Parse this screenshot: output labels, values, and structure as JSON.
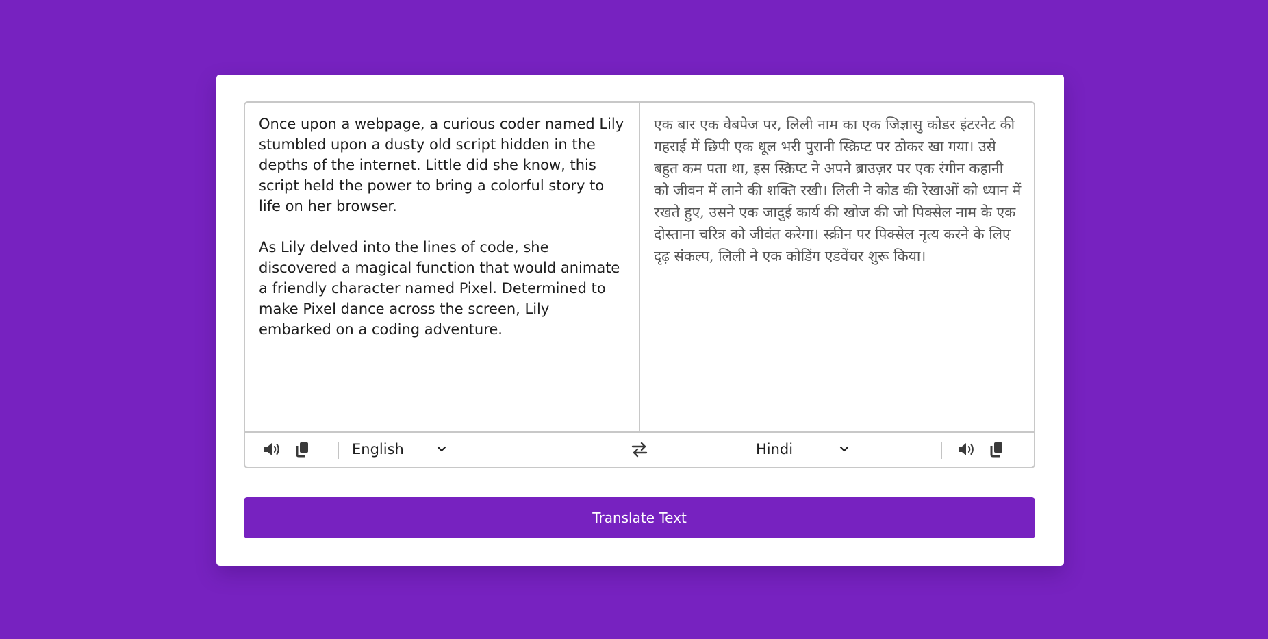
{
  "translator": {
    "source_text": "Once upon a webpage, a curious coder named Lily stumbled upon a dusty old script hidden in the depths of the internet. Little did she know, this script held the power to bring a colorful story to life on her browser.\n\nAs Lily delved into the lines of code, she discovered a magical function that would animate a friendly character named Pixel. Determined to make Pixel dance across the screen, Lily embarked on a coding adventure.",
    "translated_text": "एक बार एक वेबपेज पर, लिली नाम का एक जिज्ञासु कोडर इंटरनेट की गहराई में छिपी एक धूल भरी पुरानी स्क्रिप्ट पर ठोकर खा गया। उसे बहुत कम पता था, इस स्क्रिप्ट ने अपने ब्राउज़र पर एक रंगीन कहानी को जीवन में लाने की शक्ति रखी। लिली ने कोड की रेखाओं को ध्यान में रखते हुए, उसने एक जादुई कार्य की खोज की जो पिक्सेल नाम के एक दोस्ताना चरित्र को जीवंत करेगा। स्क्रीन पर पिक्सेल नृत्य करने के लिए दृढ़ संकल्प, लिली ने एक कोडिंग एडवेंचर शुरू किया।",
    "from_language": "English",
    "to_language": "Hindi",
    "button_label": "Translate Text"
  },
  "icons": {
    "speak": "volume-icon",
    "copy": "copy-icon",
    "swap": "swap-arrows-icon",
    "dropdown": "chevron-down-icon"
  },
  "colors": {
    "accent": "#7722c0",
    "card": "#ffffff",
    "border": "#c8c8c8"
  }
}
